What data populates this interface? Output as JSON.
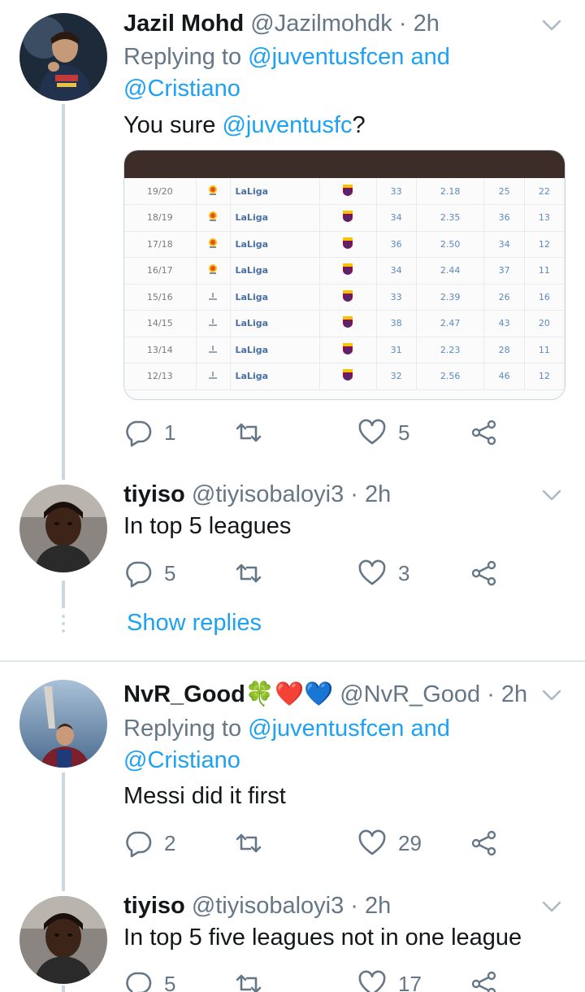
{
  "tweets": [
    {
      "name": "Jazil Mohd",
      "handle": "@Jazilmohdk",
      "time": "· 2h",
      "replying_prefix": "Replying to",
      "replying_to_1": "@juventusfcen",
      "replying_and": "and",
      "replying_to_2": "@Cristiano",
      "text_plain": "You sure",
      "text_link": "@juventusfc",
      "text_end": "?",
      "replies": "1",
      "retweets": "",
      "likes": "5"
    },
    {
      "name": "tiyiso",
      "handle": "@tiyisobaloyi3",
      "time": "· 2h",
      "text": "In top 5 leagues",
      "replies": "5",
      "retweets": "",
      "likes": "3"
    },
    {
      "name": "NvR_Good",
      "name_emoji": "🍀❤️💙",
      "handle": "@NvR_Good",
      "time": "· 2h",
      "replying_prefix": "Replying to",
      "replying_to_1": "@juventusfcen",
      "replying_and": "and",
      "replying_to_2": "@Cristiano",
      "text": "Messi did it first",
      "replies": "2",
      "retweets": "",
      "likes": "29"
    },
    {
      "name": "tiyiso",
      "handle": "@tiyisobaloyi3",
      "time": "· 2h",
      "text": "In top 5 five leagues not in one league",
      "replies": "5",
      "retweets": "",
      "likes": "17"
    }
  ],
  "show_replies_label": "Show replies",
  "stats_table": {
    "rows": [
      {
        "season": "19/20",
        "league": "LaLiga",
        "apps": "33",
        "ratio": "2.18",
        "goals": "25",
        "assists": "22"
      },
      {
        "season": "18/19",
        "league": "LaLiga",
        "apps": "34",
        "ratio": "2.35",
        "goals": "36",
        "assists": "13"
      },
      {
        "season": "17/18",
        "league": "LaLiga",
        "apps": "36",
        "ratio": "2.50",
        "goals": "34",
        "assists": "12"
      },
      {
        "season": "16/17",
        "league": "LaLiga",
        "apps": "34",
        "ratio": "2.44",
        "goals": "37",
        "assists": "11"
      },
      {
        "season": "15/16",
        "league": "LaLiga",
        "apps": "33",
        "ratio": "2.39",
        "goals": "26",
        "assists": "16"
      },
      {
        "season": "14/15",
        "league": "LaLiga",
        "apps": "38",
        "ratio": "2.47",
        "goals": "43",
        "assists": "20"
      },
      {
        "season": "13/14",
        "league": "LaLiga",
        "apps": "31",
        "ratio": "2.23",
        "goals": "28",
        "assists": "11"
      },
      {
        "season": "12/13",
        "league": "LaLiga",
        "apps": "32",
        "ratio": "2.56",
        "goals": "46",
        "assists": "12"
      }
    ]
  },
  "colors": {
    "link": "#1da1f2",
    "secondary_text": "#657786",
    "thread_line": "#ccd6dd"
  },
  "icons": {
    "reply": "reply-icon",
    "retweet": "retweet-icon",
    "like": "heart-icon",
    "share": "share-icon",
    "menu": "chevron-down-icon"
  }
}
